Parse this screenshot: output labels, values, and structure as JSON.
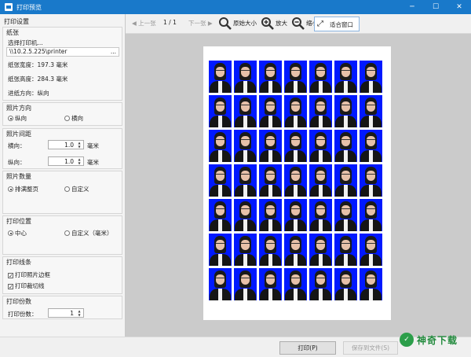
{
  "window": {
    "title": "打印预览",
    "minimize": "─",
    "maximize": "☐",
    "close": "✕"
  },
  "panel_title": "打印设置",
  "paper": {
    "group": "纸张",
    "select_printer": "选择打印机...",
    "printer_path": "\\\\10.2.5.225\\printer",
    "browse": "...",
    "width": "纸张宽度：197.3 毫米",
    "height": "纸张高度：284.3 毫米",
    "feed_direction": "进纸方向：纵向"
  },
  "orientation": {
    "group": "照片方向",
    "portrait": "纵向",
    "landscape": "横向"
  },
  "spacing": {
    "group": "照片间距",
    "horizontal_label": "横向：",
    "horizontal_value": "1.0",
    "vertical_label": "纵向：",
    "vertical_value": "1.0",
    "unit": "毫米"
  },
  "quantity": {
    "group": "照片数量",
    "full_page": "排满整页",
    "custom": "自定义"
  },
  "position": {
    "group": "打印位置",
    "center": "中心",
    "custom": "自定义（毫米）"
  },
  "lines": {
    "group": "打印线条",
    "border": "打印照片边框",
    "cut": "打印裁切线"
  },
  "copies": {
    "group": "打印份数",
    "label": "打印份数：",
    "value": "1"
  },
  "toolbar": {
    "prev": "上一张",
    "page": "1 / 1",
    "next": "下一张",
    "original": "原始大小",
    "zoom_in": "放大",
    "zoom_out": "缩小",
    "fit": "适合窗口"
  },
  "preview": {
    "rows": 7,
    "cols": 7
  },
  "buttons": {
    "print": "打印(P)",
    "save": "保存到文件(S)"
  },
  "watermark": {
    "text": "神奇下载"
  },
  "colors": {
    "titlebar": "#1979ca",
    "photo_bg": "#0019ff",
    "fit_border": "#8bb4e0"
  }
}
